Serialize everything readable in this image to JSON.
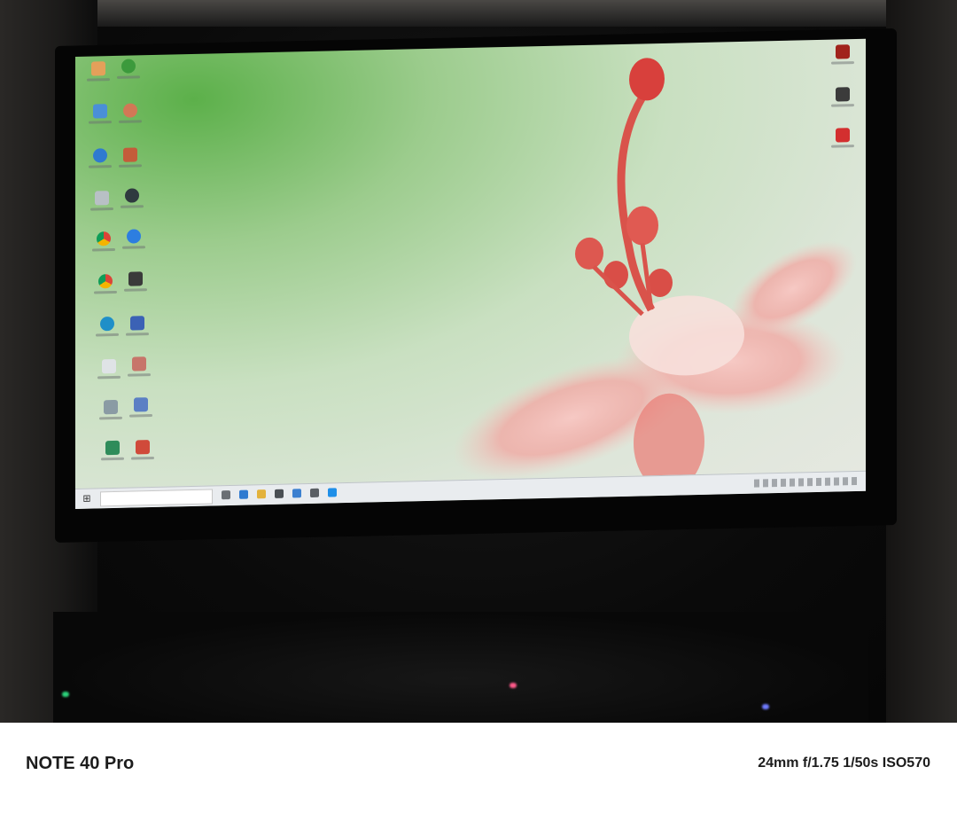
{
  "caption": {
    "device_model": "NOTE 40 Pro",
    "exif": "24mm f/1.75 1/50s ISO570"
  },
  "desktop": {
    "wallpaper": "pink-flower-on-green",
    "left_icon_names": [
      "pdf-icon",
      "torrent-icon",
      "cloud-icon",
      "user-icon",
      "edge-icon",
      "folder-icon",
      "recycle-bin-icon",
      "currency-icon",
      "chrome-icon",
      "generic-blue-icon",
      "chrome-icon",
      "app-icon",
      "edge-icon",
      "monitor-icon",
      "document-icon",
      "paint-icon",
      "app-icon",
      "app-icon",
      "app-icon",
      "app-icon"
    ],
    "right_icon_names": [
      "app-red-icon",
      "vector-icon",
      "acrobat-icon"
    ]
  },
  "colors": {
    "caption_text": "#1c1c1c",
    "caption_bg": "#ffffff"
  }
}
